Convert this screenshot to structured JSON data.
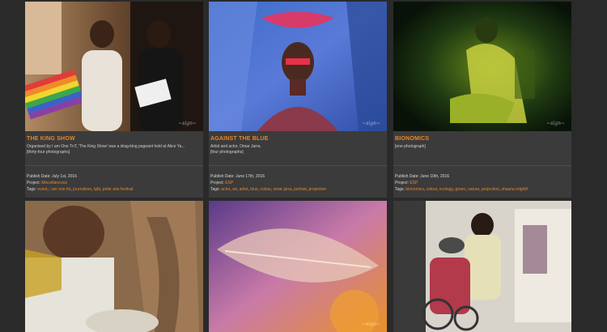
{
  "cards": [
    {
      "title": "THE KING SHOW",
      "description": "Organised by I am One TnT, 'The King Show' was a drag-king pageant held at Alice Ya...",
      "count": "[thirty-four photographs]",
      "publish_label": "Publish Date:",
      "publish_date": "July 1st, 2016",
      "project_label": "Project:",
      "project": "Miscellaneous",
      "tags_label": "Tags:",
      "tags": [
        "event",
        "i am one tnt",
        "journalism",
        "lgbt",
        "pride arts festival"
      ]
    },
    {
      "title": "AGAINST THE BLUE",
      "description": "Artist and actor, Omar Jarra.",
      "count": "[four photographs]",
      "publish_label": "Publish Date:",
      "publish_date": "June 17th, 2016",
      "project_label": "Project:",
      "project": "ESP",
      "tags_label": "Tags:",
      "tags": [
        "actor",
        "art",
        "artist",
        "blue",
        "colour",
        "omar jarra",
        "portrait",
        "projection"
      ]
    },
    {
      "title": "BIONOMICS",
      "description": "[one photograph]",
      "count": "",
      "publish_label": "Publish Date:",
      "publish_date": "June 10th, 2016",
      "project_label": "Project:",
      "project": "ESP",
      "tags_label": "Tags:",
      "tags": [
        "bionomics",
        "colour",
        "ecology",
        "green",
        "nature",
        "projection",
        "shauna edghill"
      ]
    }
  ],
  "colors": {
    "accent": "#e8862a",
    "background": "#2a2a2a",
    "card": "#3b3b3b"
  }
}
